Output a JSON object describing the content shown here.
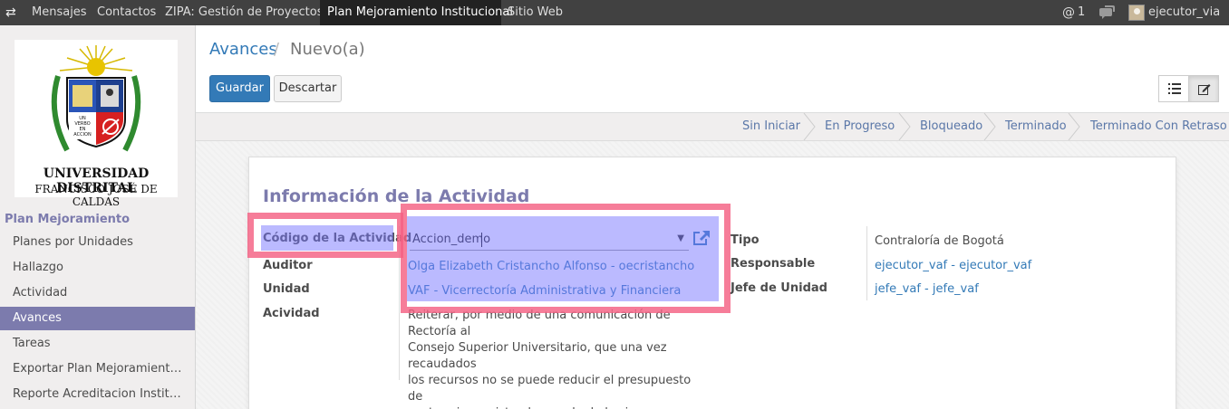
{
  "topbar": {
    "menu_icon": "exchange-icon",
    "menus": [
      {
        "label": "Mensajes",
        "active": false
      },
      {
        "label": "Contactos",
        "active": false
      },
      {
        "label": "ZIPA: Gestión de Proyectos",
        "active": false
      },
      {
        "label": "Plan Mejoramiento Institucional",
        "active": true
      },
      {
        "label": "Sitio Web",
        "active": false
      }
    ],
    "mentions_icon": "at-icon",
    "mentions_count": "1",
    "chat_icon": "chat-icon",
    "user_name": "ejecutor_via",
    "bg_color": "#414141",
    "active_bg_color": "#222222"
  },
  "sidebar": {
    "logo": {
      "line1": "UNIVERSIDAD DISTRITAL",
      "line2": "FRANCISCO JOSÉ DE CALDAS",
      "motto_lines": [
        "UN",
        "VERBO",
        "EN",
        "ACCION"
      ]
    },
    "section_title": "Plan Mejoramiento",
    "items": [
      {
        "label": "Planes por Unidades",
        "active": false
      },
      {
        "label": "Hallazgo",
        "active": false
      },
      {
        "label": "Actividad",
        "active": false
      },
      {
        "label": "Avances",
        "active": true
      },
      {
        "label": "Tareas",
        "active": false
      },
      {
        "label": "Exportar Plan Mejoramient…",
        "active": false
      },
      {
        "label": "Reporte Acreditacion Instit…",
        "active": false
      }
    ],
    "active_color": "#7c7bad"
  },
  "breadcrumb": {
    "parent": "Avances",
    "separator": "/",
    "current": "Nuevo(a)"
  },
  "buttons": {
    "save": "Guardar",
    "discard": "Descartar"
  },
  "view_switcher": [
    {
      "icon": "list-icon",
      "active": false
    },
    {
      "icon": "edit-icon",
      "active": true
    }
  ],
  "statusbar": {
    "stages": [
      "Sin Iniciar",
      "En Progreso",
      "Bloqueado",
      "Terminado",
      "Terminado Con Retraso"
    ]
  },
  "form": {
    "section_title": "Información de la Actividad",
    "left": {
      "codigo": {
        "label": "Código de la Actividad",
        "value": "Accion_demo"
      },
      "auditor": {
        "label": "Auditor",
        "value": "Olga Elizabeth Cristancho Alfonso - oecristancho"
      },
      "unidad": {
        "label": "Unidad",
        "value": "VAF - Vicerrectoría Administrativa y Financiera"
      },
      "actividad": {
        "label": "Acividad",
        "value": "Reiterar, por medio de una comunicación de Rectoría al\nConsejo Superior Universitario, que una vez recaudados\nlos recursos no se puede reducir el presupuesto de\ngastos si ya existe el recaudo de los ingresos."
      }
    },
    "right": {
      "tipo": {
        "label": "Tipo",
        "value": "Contraloría de Bogotá"
      },
      "responsable": {
        "label": "Responsable",
        "value": "ejecutor_vaf - ejecutor_vaf"
      },
      "jefe": {
        "label": "Jefe de Unidad",
        "value": "jefe_vaf - jefe_vaf"
      }
    },
    "external_link_icon": "external-link-icon",
    "link_color": "#337ab7",
    "title_color": "#7c7bad"
  },
  "highlight_colors": {
    "border": "#f46082",
    "fill": "#7876ff"
  }
}
